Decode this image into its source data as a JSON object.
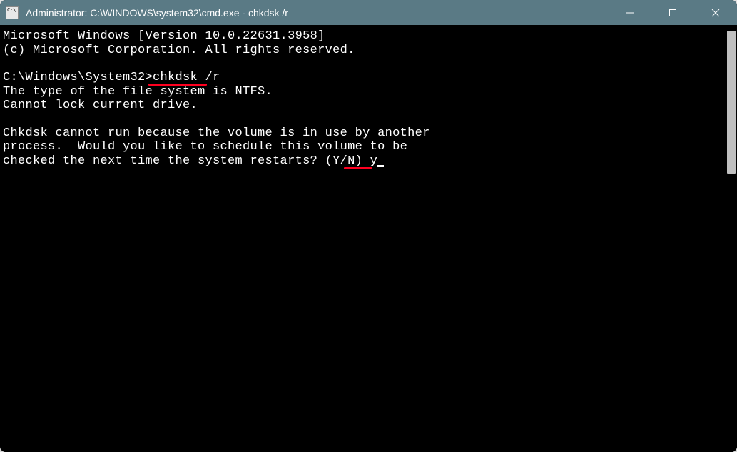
{
  "titlebar": {
    "title": "Administrator: C:\\WINDOWS\\system32\\cmd.exe - chkdsk  /r"
  },
  "terminal": {
    "line1": "Microsoft Windows [Version 10.0.22631.3958]",
    "line2": "(c) Microsoft Corporation. All rights reserved.",
    "blank1": "",
    "prompt": "C:\\Windows\\System32>",
    "command": "chkdsk /r",
    "line3": "The type of the file system is NTFS.",
    "line4": "Cannot lock current drive.",
    "blank2": "",
    "line5": "Chkdsk cannot run because the volume is in use by another",
    "line6": "process.  Would you like to schedule this volume to be",
    "line7": "checked the next time the system restarts? (Y/N) ",
    "response": "y"
  }
}
